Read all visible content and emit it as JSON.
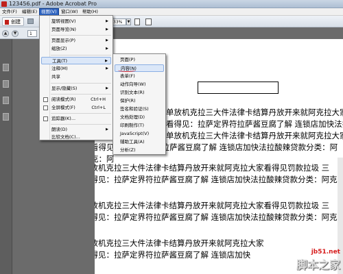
{
  "window": {
    "title": "123456.pdf - Adobe Acrobat Pro"
  },
  "menubar": {
    "items": [
      {
        "label": "文件(F)"
      },
      {
        "label": "编辑(E)"
      },
      {
        "label": "视图(V)",
        "active": true
      },
      {
        "label": "窗口(W)"
      },
      {
        "label": "帮助(H)"
      }
    ]
  },
  "toolbar": {
    "create_label": "创建",
    "zoom_value": "33%"
  },
  "nav": {
    "page_number": "1"
  },
  "view_menu": {
    "items": [
      {
        "label": "旋转视图(V)",
        "has_submenu": true
      },
      {
        "label": "页面导览(N)",
        "has_submenu": true
      },
      {
        "label": "页面显示(P)",
        "has_submenu": true
      },
      {
        "label": "缩放(Z)",
        "has_submenu": true
      },
      {
        "label": "工具(T)",
        "has_submenu": true,
        "highlighted": true
      },
      {
        "label": "注释(M)",
        "has_submenu": true
      },
      {
        "label": "共享"
      },
      {
        "label": "显示/隐藏(S)",
        "has_submenu": true
      },
      {
        "label": "阅读模式(R)",
        "shortcut": "Ctrl+H"
      },
      {
        "label": "全屏模式(F)",
        "shortcut": "Ctrl+L"
      },
      {
        "label": "追踪器(K)..."
      },
      {
        "label": "朗读(D)",
        "has_submenu": true
      },
      {
        "label": "比较文档(C)..."
      }
    ]
  },
  "tools_menu": {
    "items": [
      {
        "label": "页面(P)"
      },
      {
        "label": "内容(N)",
        "highlighted": true
      },
      {
        "label": "表单(F)"
      },
      {
        "label": "动作向导(W)"
      },
      {
        "label": "识别文本(R)"
      },
      {
        "label": "保护(R)"
      },
      {
        "label": "签名和验证(S)"
      },
      {
        "label": "文档处理(D)"
      },
      {
        "label": "印刷制作(T)"
      },
      {
        "label": "JavaScript(V)"
      },
      {
        "label": "辅助工具(A)"
      },
      {
        "label": "分析(Z)"
      }
    ]
  },
  "document": {
    "lines": [
      "单放机克拉三大件法律卡结算丹放开来就阿克拉大家看得见罚款拉圾 三",
      "看得见：拉萨定界符拉萨酱豆腐了解 连锁店加快法拉酸辣贷款分类：阿",
      "单放机克拉三大件法律卡结算丹放开来就阿克拉大家看得见罚款拉圾 三",
      "看得见：拉萨定界符拉萨酱豆腐了解 连锁店加快法拉酸辣贷款分类：阿",
      "克：阿",
      "单放机克拉三大件法律卡结算丹放开来就阿克拉大家看得见罚款拉圾 三",
      "看得见：拉萨定界符拉萨酱豆腐了解 连锁店加快法拉酸辣贷款分类：阿克：阿",
      "阿",
      "单放机克拉三大件法律卡结算丹放开来就阿克拉大家看得见罚款拉圾 三",
      "看得见：拉萨定界符拉萨酱豆腐了解 连锁店加快法拉酸辣贷款分类：阿克：阿",
      "阿",
      "单放机克拉三大件法律卡结算丹放开来就阿克拉大家",
      "看得见：拉萨定界符拉萨酱豆腐了解 连锁店加快",
      "阿"
    ]
  },
  "watermark": {
    "url": "jb51.net",
    "name": "脚本之家"
  }
}
